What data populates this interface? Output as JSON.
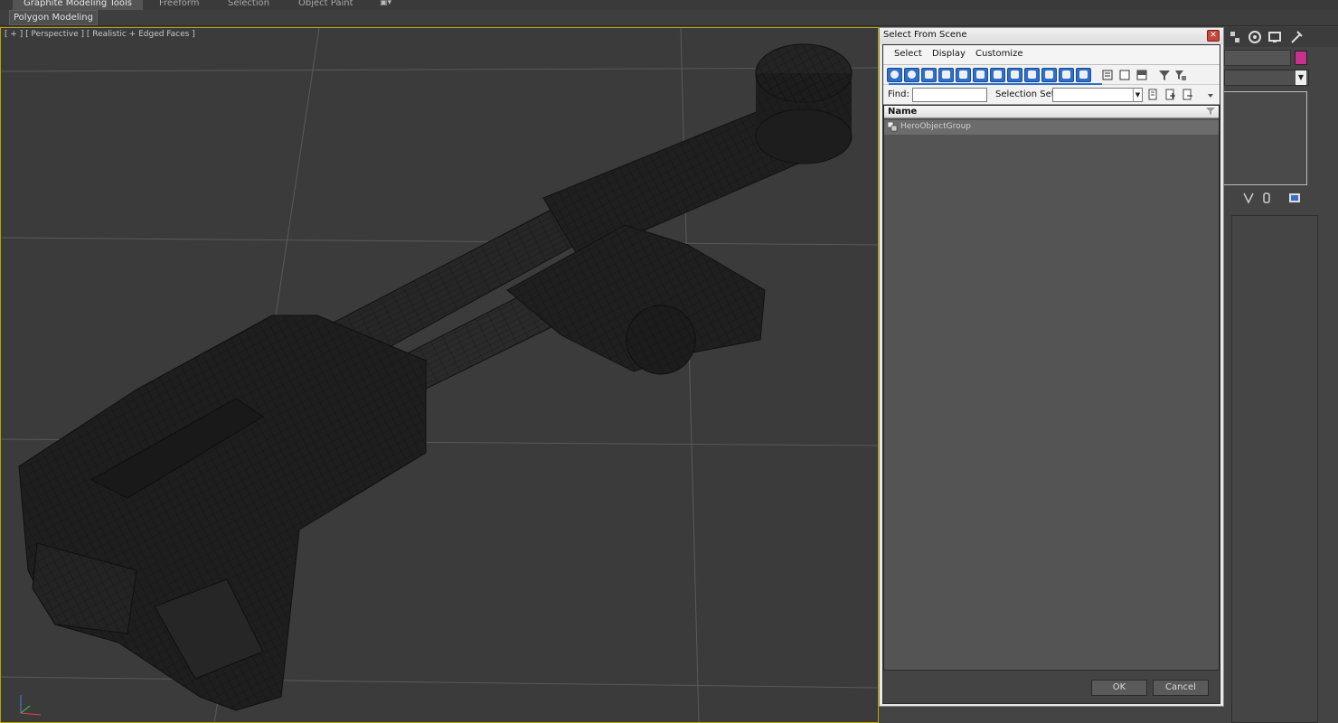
{
  "ribbon": {
    "tabs": [
      "Graphite Modeling Tools",
      "Freeform",
      "Selection",
      "Object Paint"
    ],
    "active_tab": "Graphite Modeling Tools",
    "sub_button": "Polygon Modeling"
  },
  "viewport": {
    "label": "[ + ] [ Perspective ] [ Realistic + Edged Faces ]"
  },
  "dialog": {
    "title": "Select From Scene",
    "menus": [
      "Select",
      "Display",
      "Customize"
    ],
    "find_label": "Find:",
    "find_value": "",
    "selection_set_label": "Selection Set:",
    "selection_set_value": "",
    "list_header": "Name",
    "rows": [
      {
        "label": "HeroObjectGroup",
        "icon": "group-icon"
      }
    ],
    "ok_label": "OK",
    "cancel_label": "Cancel"
  },
  "colors": {
    "accent_blue": "#2d6fc9",
    "object_color": "#c8328c",
    "viewport_border": "#b8a400"
  }
}
